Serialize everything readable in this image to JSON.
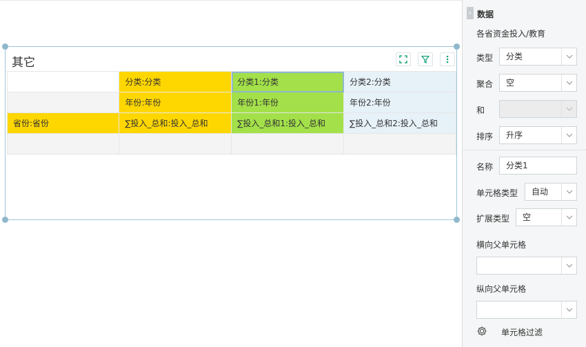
{
  "widget": {
    "title": "其它",
    "icons": [
      "expand-icon",
      "filter-icon",
      "more-icon"
    ]
  },
  "grid": {
    "rows": [
      [
        "",
        "分类:分类",
        "分类1:分类",
        "分类2:分类"
      ],
      [
        "",
        "年份:年份",
        "年份1:年份",
        "年份2:年份"
      ],
      [
        "省份:省份",
        "∑投入_总和:投入_总和",
        "∑投入_总和1:投入_总和",
        "∑投入_总和2:投入_总和"
      ],
      [
        "",
        "",
        "",
        ""
      ]
    ]
  },
  "panel": {
    "title": "数据",
    "dataset": "各省资金投入/教育",
    "type_label": "类型",
    "type_value": "分类",
    "agg_label": "聚合",
    "agg_value": "空",
    "sum_label": "和",
    "sum_value": "",
    "sort_label": "排序",
    "sort_value": "升序",
    "name_label": "名称",
    "name_value": "分类1",
    "cell_type_label": "单元格类型",
    "cell_type_value": "自动",
    "expand_label": "扩展类型",
    "expand_value": "空",
    "h_parent_label": "横向父单元格",
    "h_parent_value": "",
    "v_parent_label": "纵向父单元格",
    "v_parent_value": "",
    "filter_label": "单元格过滤"
  },
  "colors": {
    "yellow": "#ffd700",
    "green": "#a3e04a",
    "blue": "#e6f1f8",
    "accent": "#1aa37a"
  }
}
